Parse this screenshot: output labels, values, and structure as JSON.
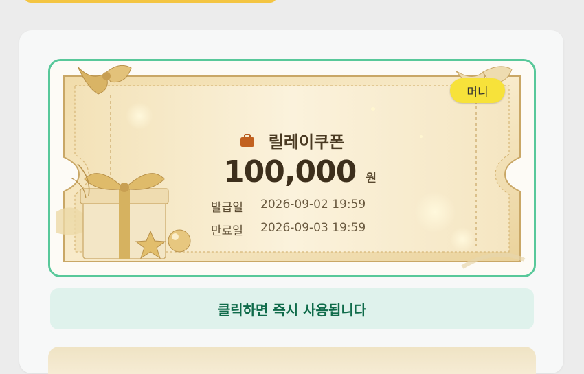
{
  "coupon": {
    "badge": "머니",
    "title": "릴레이쿠폰",
    "amount": "100,000",
    "unit": "원",
    "issued_label": "발급일",
    "issued_value": "2026-09-02 19:59",
    "expires_label": "만료일",
    "expires_value": "2026-09-03 19:59",
    "title_icon": "briefcase-icon"
  },
  "action": {
    "label": "클릭하면 즉시 사용됩니다"
  },
  "colors": {
    "card_border": "#58c89a",
    "badge_bg": "#f7e23a",
    "action_bg": "#dff2ec",
    "action_text": "#0f6b4a",
    "top_strip": "#f4c542"
  }
}
